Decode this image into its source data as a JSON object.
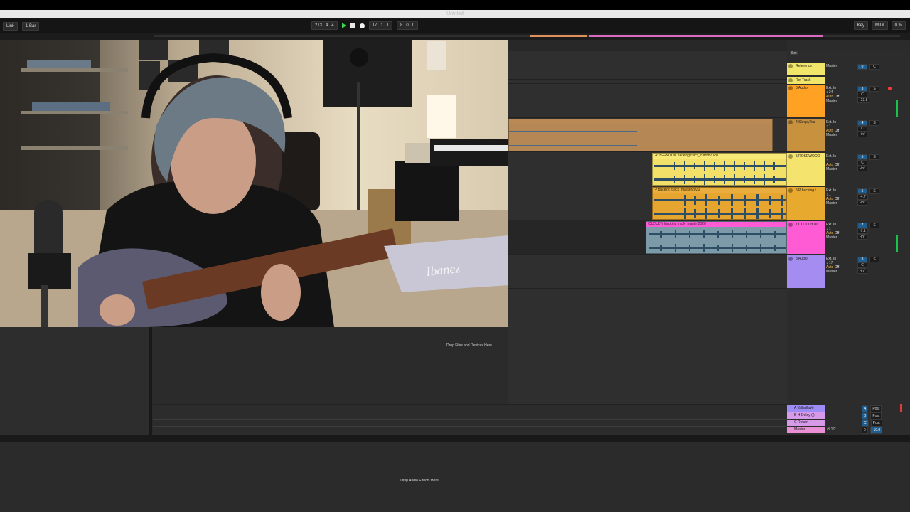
{
  "window": {
    "title": "Untitled"
  },
  "controlbar": {
    "left": [
      "Link",
      "1 Bar"
    ],
    "tempo_position": "213 . 4 . 4",
    "loop_position": "17 . 1 . 1",
    "loop_length": "8 . 0 . 0",
    "right": [
      "Key",
      "MIDI",
      "0 %"
    ]
  },
  "arrangement": {
    "drop_hint": "Drop Files and Devices Here"
  },
  "mixer": {
    "set_label": "Set",
    "tracks": [
      {
        "name": "Reference",
        "color": "#f2e66a",
        "io_in": "",
        "io_out": "Master",
        "volume": "0",
        "pan": "C",
        "auto": "",
        "off": ""
      },
      {
        "name": "Ref Track",
        "color": "#f2e66a",
        "io_in": "",
        "io_out": "",
        "volume": "",
        "pan": "",
        "auto": "",
        "off": ""
      },
      {
        "name": "3 Audio",
        "color": "#ffa224",
        "io_in": "Ext. In",
        "io_ch": "↕ 24",
        "io_out": "Master",
        "volume": "-23.8",
        "pan": "C",
        "auto": "Auto",
        "off": "Off",
        "track_num": "3"
      },
      {
        "name": "4 SleepyTea",
        "color": "#c8913e",
        "io_in": "Ext. In",
        "io_ch": "↕ 1",
        "io_out": "Master",
        "volume": "-inf",
        "pan": "C",
        "auto": "Auto",
        "off": "Off",
        "track_num": "4"
      },
      {
        "name": "5 ROSEWOOD",
        "color": "#f4e36c",
        "io_in": "Ext. In",
        "io_ch": "↕ 1",
        "io_out": "Master",
        "volume": "-inf",
        "pan": "C",
        "auto": "Auto",
        "off": "Off",
        "track_num": "5"
      },
      {
        "name": "6 P backing t",
        "color": "#e8a92f",
        "io_in": "Ext. In",
        "io_ch": "↕ 1",
        "io_out": "Master",
        "volume": "-inf",
        "pan": "-4.7",
        "auto": "Auto",
        "off": "Off",
        "track_num": "6"
      },
      {
        "name": "7 CLOUDY ba",
        "color": "#ff5bd5",
        "io_in": "Ext. In",
        "io_ch": "↕ 1",
        "io_out": "Master",
        "volume": "-inf",
        "pan": "-7.1",
        "auto": "Auto",
        "off": "Off",
        "track_num": "7"
      },
      {
        "name": "8 Audio",
        "color": "#a48cf0",
        "io_in": "Ext. In",
        "io_ch": "↕ 17",
        "io_out": "Master",
        "volume": "-inf",
        "pan": "C",
        "auto": "Auto",
        "off": "Off",
        "track_num": "8"
      }
    ],
    "returns": [
      {
        "name": "A ValhallaVe",
        "color": "#9d8cf4",
        "label": "A",
        "mode": "Post"
      },
      {
        "name": "B H-Delay (l)",
        "color": "#d69ae8",
        "label": "B",
        "mode": "Post"
      },
      {
        "name": "C Return",
        "color": "#d69ae8",
        "label": "C",
        "mode": "Post"
      },
      {
        "name": "Master",
        "color": "#e88fd6",
        "label": "0",
        "mode": "-10.0",
        "io": "↺ 1/2"
      }
    ]
  },
  "clips": [
    {
      "track": "4 SleepyTea",
      "name": "",
      "color": "#b98a55"
    },
    {
      "track": "5 ROSEWOOD",
      "name": "ROSEWOOD backing track_cutom2020",
      "color": "#f4e36c"
    },
    {
      "track": "6 P backing t",
      "name": "P backing track_master2020",
      "color": "#e8a92f"
    },
    {
      "track": "7 CLOUDY ba",
      "name": "CLOUDY backing track_master2020",
      "color": "#ff5bd5"
    }
  ],
  "device_view": {
    "drop_hint": "Drop Audio Effects Here"
  },
  "webcam": {
    "guitar_brand": "Ibanez"
  }
}
